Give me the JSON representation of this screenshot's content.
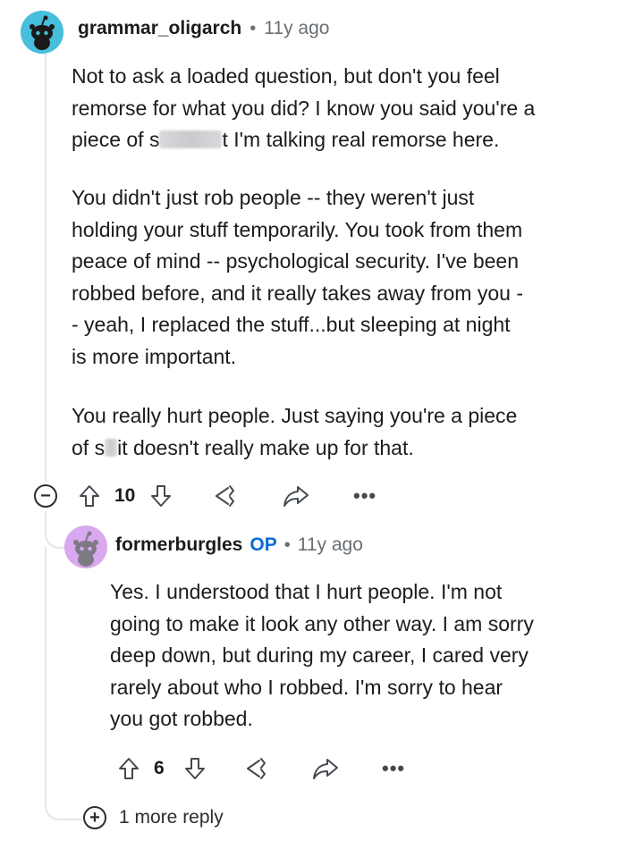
{
  "comment": {
    "username": "grammar_oligarch",
    "separator": "•",
    "time": "11y ago",
    "paragraphs": [
      {
        "lines": [
          "Not to ask a loaded question, but don't you feel",
          "remorse for what you did? I know you said you're a"
        ]
      },
      {
        "line3_prefix": "piece of s",
        "line3_suffix": "t I'm talking real remorse here."
      },
      {
        "lines": [
          "You didn't just rob people -- they weren't just",
          "holding your stuff temporarily. You took from them",
          "peace of mind -- psychological security. I've been",
          "robbed before, and it really takes away from you -",
          "- yeah, I replaced the stuff...but sleeping at night",
          "is more important."
        ]
      },
      {
        "line1": "You really hurt people. Just saying you're a piece",
        "line2_prefix": "of s",
        "line2_suffix": "it doesn't really make up for that."
      }
    ],
    "votes": "10",
    "more_label": "•••",
    "collapse_symbol": "−"
  },
  "reply": {
    "username": "formerburgles",
    "op_badge": "OP",
    "separator": "•",
    "time": "11y ago",
    "lines": [
      "Yes. I understood that I hurt people. I'm not",
      "going to make it look any other way. I am sorry",
      "deep down, but during my career, I cared very",
      "rarely about who I robbed. I'm sorry to hear",
      "you got robbed."
    ],
    "votes": "6",
    "more_label": "•••"
  },
  "more_replies": {
    "symbol": "+",
    "label": "1 more reply"
  },
  "colors": {
    "avatar_1_bg": "#46bedc",
    "avatar_2_bg": "#d8a9ee",
    "op_blue": "#0a6bd8",
    "meta_gray": "#6a6f73"
  }
}
